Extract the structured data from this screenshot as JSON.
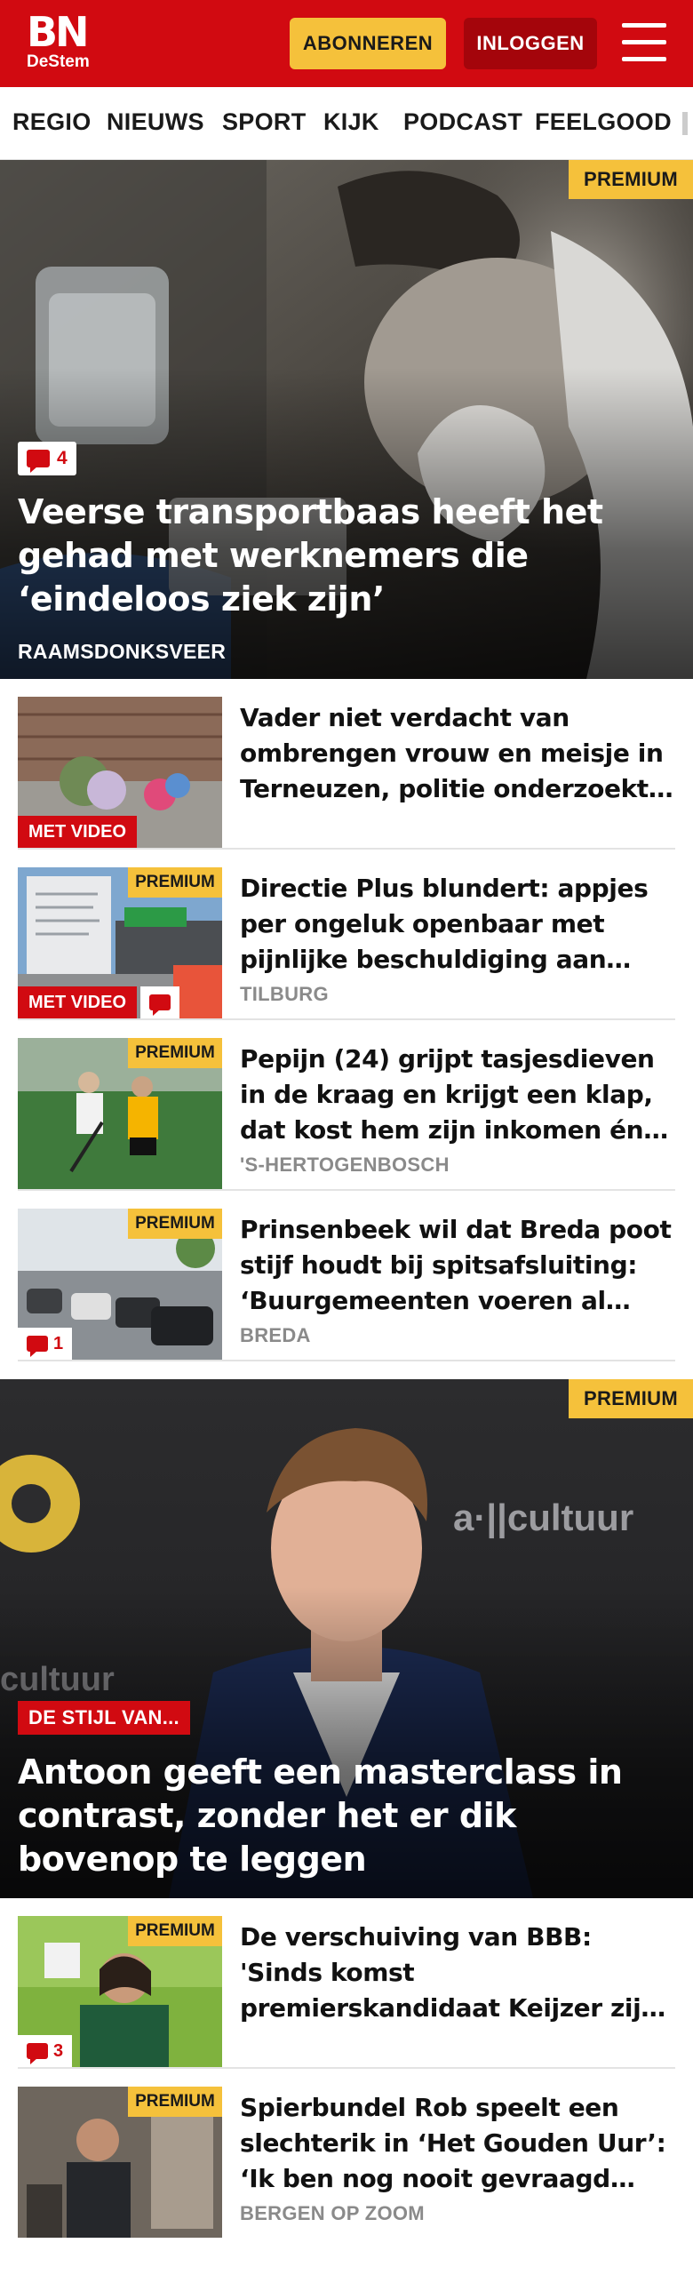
{
  "header": {
    "logo_main": "BN",
    "logo_sub": "DeStem",
    "subscribe_label": "ABONNEREN",
    "login_label": "INLOGGEN",
    "menu_icon": "hamburger-menu-icon",
    "brand_color": "#d10a11",
    "subscribe_color": "#f5c13b"
  },
  "nav": {
    "items": [
      "REGIO",
      "NIEUWS",
      "SPORT",
      "KIJK",
      "PODCAST",
      "FEELGOOD"
    ]
  },
  "hero1": {
    "premium": "PREMIUM",
    "comments": "4",
    "title": "Veerse transportbaas heeft het gehad met werknemers die ‘eindeloos ziek zijn’",
    "location": "RAAMSDONKSVEER"
  },
  "articles": [
    {
      "title": "Vader niet verdacht van ombrengen vrouw en meisje in Terneuzen, politie onderzoekt…",
      "video": "MET VIDEO"
    },
    {
      "title": "Directie Plus blundert: appjes per ongeluk openbaar met pijnlijke beschuldiging aan loka…",
      "premium": "PREMIUM",
      "video": "MET VIDEO",
      "location": "TILBURG"
    },
    {
      "title": "Pepijn (24) grijpt tasjesdieven in de kraag en krijgt een klap, dat kost hem zijn inkomen én kans i…",
      "premium": "PREMIUM",
      "location": "'S-HERTOGENBOSCH"
    },
    {
      "title": "Prinsenbeek wil dat Breda poot stijf houdt bij spitsafsluiting: ‘Buurgemeenten voeren al jare…",
      "premium": "PREMIUM",
      "comments": "1",
      "location": "BREDA"
    }
  ],
  "hero2": {
    "premium": "PREMIUM",
    "label": "DE STIJL VAN...",
    "title": "Antoon geeft een masterclass in contrast, zonder het er dik bovenop te leggen"
  },
  "articles2": [
    {
      "title": "De verschuiving van BBB: 'Sinds komst premierskandidaat Keijzer zijn we steeds harder geworden…",
      "premium": "PREMIUM",
      "comments": "3"
    },
    {
      "title": "Spierbundel Rob speelt een slechterik in ‘Het Gouden Uur’: ‘Ik ben nog nooit gevraagd voor ee…",
      "premium": "PREMIUM",
      "location": "BERGEN OP ZOOM"
    }
  ]
}
